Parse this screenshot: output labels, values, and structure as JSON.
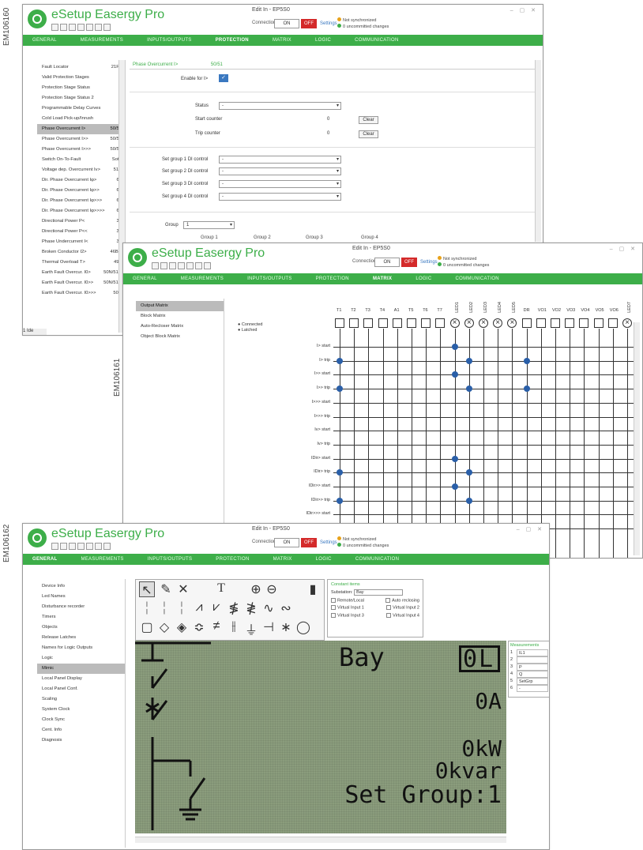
{
  "labels": {
    "em1": "EM106160",
    "em2": "EM106161",
    "em3": "EM106162"
  },
  "colors": {
    "brand_green": "#3dae49",
    "off_red": "#d42a2a",
    "dot_blue": "#2a5fa8",
    "lcd_bg": "#8a9c7c"
  },
  "app": {
    "title": "eSetup Easergy Pro",
    "device": "Edit In - EP5S0",
    "connection_label": "Connection",
    "on_label": "ON",
    "off_label": "OFF",
    "settings_label": "Settings",
    "status1": "Not synchronized",
    "status2": "0 uncommitted changes"
  },
  "menu": [
    "GENERAL",
    "MEASUREMENTS",
    "INPUTS/OUTPUTS",
    "PROTECTION",
    "MATRIX",
    "LOGIC",
    "COMMUNICATION"
  ],
  "win1": {
    "active_menu": "PROTECTION",
    "sidebar": [
      {
        "label": "Fault Locator",
        "code": "21FL"
      },
      {
        "label": "Valid Protection Stages",
        "code": ""
      },
      {
        "label": "Protection Stage Status",
        "code": ""
      },
      {
        "label": "Protection Stage Status 2",
        "code": ""
      },
      {
        "label": "Programmable Delay Curves",
        "code": ""
      },
      {
        "label": "Cold Load Pick-up/Inrush",
        "code": ""
      },
      {
        "label": "Phase Overcurrent I>",
        "code": "50/51"
      },
      {
        "label": "Phase Overcurrent I>>",
        "code": "50/51"
      },
      {
        "label": "Phase Overcurrent I>>>",
        "code": "50/51"
      },
      {
        "label": "Switch On-To-Fault",
        "code": "SotF"
      },
      {
        "label": "Voltage dep. Overcurrent Iv>",
        "code": "51V"
      },
      {
        "label": "Dir. Phase Overcurrent Iφ>",
        "code": "67"
      },
      {
        "label": "Dir. Phase Overcurrent Iφ>>",
        "code": "67"
      },
      {
        "label": "Dir. Phase Overcurrent Iφ>>>",
        "code": "67"
      },
      {
        "label": "Dir. Phase Overcurrent Iφ>>>>",
        "code": "67"
      },
      {
        "label": "Directional Power P<",
        "code": "32"
      },
      {
        "label": "Directional Power P<<",
        "code": "32"
      },
      {
        "label": "Phase Undercurrent I<",
        "code": "37"
      },
      {
        "label": "Broken Conductor I2>",
        "code": "46BC"
      },
      {
        "label": "Thermal Overload T>",
        "code": "49F"
      },
      {
        "label": "Earth Fault Overcur. I0>",
        "code": "50N/51N"
      },
      {
        "label": "Earth Fault Overcur. I0>>",
        "code": "50N/51N"
      },
      {
        "label": "Earth Fault Overcur. I0>>>",
        "code": "50N"
      }
    ],
    "selected_index": 6,
    "header": {
      "title": "Phase Overcurrent I>",
      "code": "50/51"
    },
    "enable_label": "Enable for I>",
    "status_label": "Status",
    "status_value": "-",
    "start_counter_label": "Start counter",
    "start_counter_value": "0",
    "trip_counter_label": "Trip counter",
    "trip_counter_value": "0",
    "clear_label": "Clear",
    "setgroups": [
      {
        "label": "Set group 1 DI control",
        "value": "-"
      },
      {
        "label": "Set group 2 DI control",
        "value": "-"
      },
      {
        "label": "Set group 3 DI control",
        "value": "-"
      },
      {
        "label": "Set group 4 DI control",
        "value": "-"
      }
    ],
    "group_label": "Group",
    "group_value": "1",
    "group_cols": [
      "Group 1",
      "Group 2",
      "Group 3",
      "Group 4"
    ],
    "bottom": "1 Ide"
  },
  "win2": {
    "active_menu": "MATRIX",
    "sidebar": [
      "Output Matrix",
      "Block Matrix",
      "Auto-Recloser Matrix",
      "Object Block Matrix"
    ],
    "selected_index": 0,
    "legend": [
      "Connected",
      "Latched"
    ],
    "columns": [
      "T1",
      "T2",
      "T3",
      "T4",
      "A1",
      "T5",
      "T6",
      "T7",
      "LED1",
      "LED2",
      "LED3",
      "LED4",
      "LED5",
      "DR",
      "VO1",
      "VO2",
      "VO3",
      "VO4",
      "VO5",
      "VO6",
      "LED7"
    ],
    "rows": [
      "I> start",
      "I> trip",
      "I>> start",
      "I>> trip",
      "I>>> start",
      "I>>> trip",
      "Iv> start",
      "Iv> trip",
      "IDir> start",
      "IDir> trip",
      "IDir>> start",
      "IDir>> trip",
      "IDir>>> start",
      "IDir>>> trip"
    ],
    "connections": [
      [
        0,
        8
      ],
      [
        1,
        0
      ],
      [
        1,
        9
      ],
      [
        1,
        13
      ],
      [
        2,
        8
      ],
      [
        3,
        0
      ],
      [
        3,
        9
      ],
      [
        3,
        13
      ],
      [
        8,
        8
      ],
      [
        9,
        0
      ],
      [
        9,
        9
      ],
      [
        10,
        8
      ],
      [
        11,
        0
      ],
      [
        11,
        9
      ]
    ]
  },
  "win3": {
    "active_menu": "GENERAL",
    "sidebar": [
      "Device Info",
      "Led Names",
      "Disturbance recorder",
      "Timers",
      "Objects",
      "Release Latches",
      "Names for Logic Outputs",
      "Logic",
      "Mimic",
      "Local Panel Display",
      "Local Panel Conf.",
      "Scaling",
      "System Clock",
      "Clock Sync",
      "Cent. Info",
      "Diagnosis"
    ],
    "selected_index": 8,
    "tools_row1": [
      "⬚",
      "✎",
      "✕",
      "T",
      "⊕",
      "⊖",
      "▮"
    ],
    "mimic_props": {
      "title": "Constant items",
      "substation_label": "Substation:",
      "substation_value": "Bay",
      "remote_local": "Remote/Local",
      "auto_reclosing": "Auto reclosing",
      "vinput1": "Virtual Input 1",
      "vinput2": "Virtual Input 2",
      "vinput3": "Virtual Input 3",
      "vinput4": "Virtual Input 4"
    },
    "lcd": {
      "bay": "Bay",
      "mode": "0L",
      "current": "0A",
      "power": "0kW",
      "reactive": "0kvar",
      "setgroup": "Set Group:1"
    },
    "measurements": {
      "title": "Measurements",
      "rows": [
        {
          "n": "1",
          "v": "IL1"
        },
        {
          "n": "2",
          "v": ""
        },
        {
          "n": "3",
          "v": "P"
        },
        {
          "n": "4",
          "v": "Q"
        },
        {
          "n": "5",
          "v": "SetGrp"
        },
        {
          "n": "6",
          "v": "-"
        }
      ]
    }
  }
}
